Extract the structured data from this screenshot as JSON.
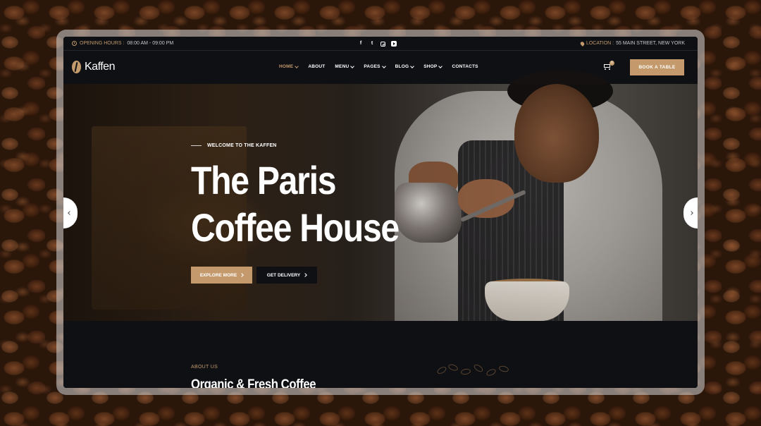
{
  "topbar": {
    "hours_label": "OPENING HOURS :",
    "hours_value": "08:00 AM - 09:00 PM",
    "location_label": "LOCATION :",
    "location_value": "55 MAIN STREET, NEW YORK",
    "social_icons": [
      "facebook-icon",
      "twitter-icon",
      "instagram-icon",
      "youtube-icon"
    ]
  },
  "nav": {
    "logo_text": "Kaffen",
    "items": [
      {
        "label": "HOME",
        "has_dropdown": true,
        "active": true
      },
      {
        "label": "ABOUT",
        "has_dropdown": false
      },
      {
        "label": "MENU",
        "has_dropdown": true
      },
      {
        "label": "PAGES",
        "has_dropdown": true
      },
      {
        "label": "BLOG",
        "has_dropdown": true
      },
      {
        "label": "SHOP",
        "has_dropdown": true
      },
      {
        "label": "CONTACTS",
        "has_dropdown": false
      }
    ],
    "cart_count": "0",
    "cta_label": "BOOK A TABLE"
  },
  "hero": {
    "kicker": "WELCOME TO THE KAFFEN",
    "title_line1": "The Paris",
    "title_line2": "Coffee House",
    "primary_button": "EXPLORE MORE",
    "secondary_button": "GET DELIVERY"
  },
  "about": {
    "kicker": "ABOUT US",
    "title": "Organic & Fresh Coffee"
  },
  "colors": {
    "accent": "#c49a6c",
    "dark": "#0e1014",
    "text": "#ffffff"
  }
}
